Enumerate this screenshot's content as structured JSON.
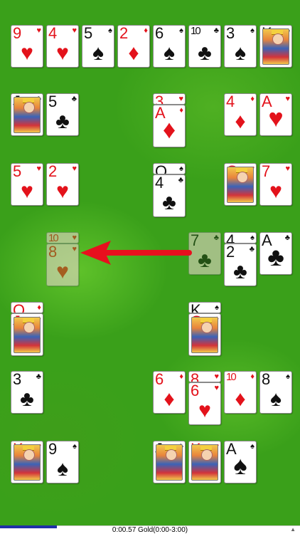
{
  "status": {
    "timer_text": "0:00.57 Gold(0:00-3:00)",
    "progress_fraction": 0.19,
    "corner_mark": "▲"
  },
  "colors": {
    "felt": "#3aa01a",
    "red": "#e3121b",
    "black": "#111111",
    "arrow": "#e8101e"
  },
  "hint": {
    "from": "7♣",
    "to": "8♥"
  },
  "rows": [
    {
      "name": "row-1",
      "cards": [
        {
          "rank": "9",
          "suit": "♥"
        },
        {
          "rank": "4",
          "suit": "♥"
        },
        {
          "rank": "5",
          "suit": "♠"
        },
        {
          "rank": "2",
          "suit": "♦"
        },
        {
          "rank": "6",
          "suit": "♠"
        },
        {
          "rank": "10",
          "suit": "♣"
        },
        {
          "rank": "3",
          "suit": "♠"
        },
        {
          "rank": "K",
          "suit": "♠"
        }
      ]
    }
  ],
  "piles": {
    "p2a": [
      {
        "rank": "J",
        "suit": "♣"
      }
    ],
    "p2b": [
      {
        "rank": "5",
        "suit": "♣"
      }
    ],
    "p2c": [
      {
        "rank": "3",
        "suit": "♥"
      },
      {
        "rank": "A",
        "suit": "♦"
      }
    ],
    "p2d": [
      {
        "rank": "4",
        "suit": "♦"
      }
    ],
    "p2e": [
      {
        "rank": "A",
        "suit": "♥"
      }
    ],
    "p3a": [
      {
        "rank": "5",
        "suit": "♥"
      }
    ],
    "p3b": [
      {
        "rank": "2",
        "suit": "♥"
      }
    ],
    "p3c": [
      {
        "rank": "Q",
        "suit": "♠"
      },
      {
        "rank": "4",
        "suit": "♣"
      }
    ],
    "p3d": [
      {
        "rank": "Q",
        "suit": "♥"
      }
    ],
    "p3e": [
      {
        "rank": "7",
        "suit": "♥"
      }
    ],
    "p4a": [
      {
        "rank": "10",
        "suit": "♥"
      },
      {
        "rank": "8",
        "suit": "♥"
      }
    ],
    "p4b": [
      {
        "rank": "7",
        "suit": "♣"
      }
    ],
    "p4c": [
      {
        "rank": "4",
        "suit": "♠"
      },
      {
        "rank": "2",
        "suit": "♣"
      }
    ],
    "p4d": [
      {
        "rank": "A",
        "suit": "♣"
      }
    ],
    "p5a": [
      {
        "rank": "Q",
        "suit": "♦"
      },
      {
        "rank": "J",
        "suit": "♦"
      }
    ],
    "p5b": [
      {
        "rank": "K",
        "suit": "♠"
      },
      {
        "rank": "Q",
        "suit": "♦"
      }
    ],
    "p6a": [
      {
        "rank": "3",
        "suit": "♣"
      }
    ],
    "p6b": [
      {
        "rank": "6",
        "suit": "♦"
      }
    ],
    "p6c": [
      {
        "rank": "8",
        "suit": "♥"
      },
      {
        "rank": "6",
        "suit": "♥"
      }
    ],
    "p6d": [
      {
        "rank": "10",
        "suit": "♦"
      }
    ],
    "p6e": [
      {
        "rank": "8",
        "suit": "♠"
      }
    ],
    "p7a": [
      {
        "rank": "K",
        "suit": "♥"
      }
    ],
    "p7b": [
      {
        "rank": "9",
        "suit": "♠"
      }
    ],
    "p7c": [
      {
        "rank": "J",
        "suit": "♣"
      }
    ],
    "p7d": [
      {
        "rank": "K",
        "suit": "♥"
      }
    ],
    "p7e": [
      {
        "rank": "A",
        "suit": "♠"
      }
    ]
  }
}
